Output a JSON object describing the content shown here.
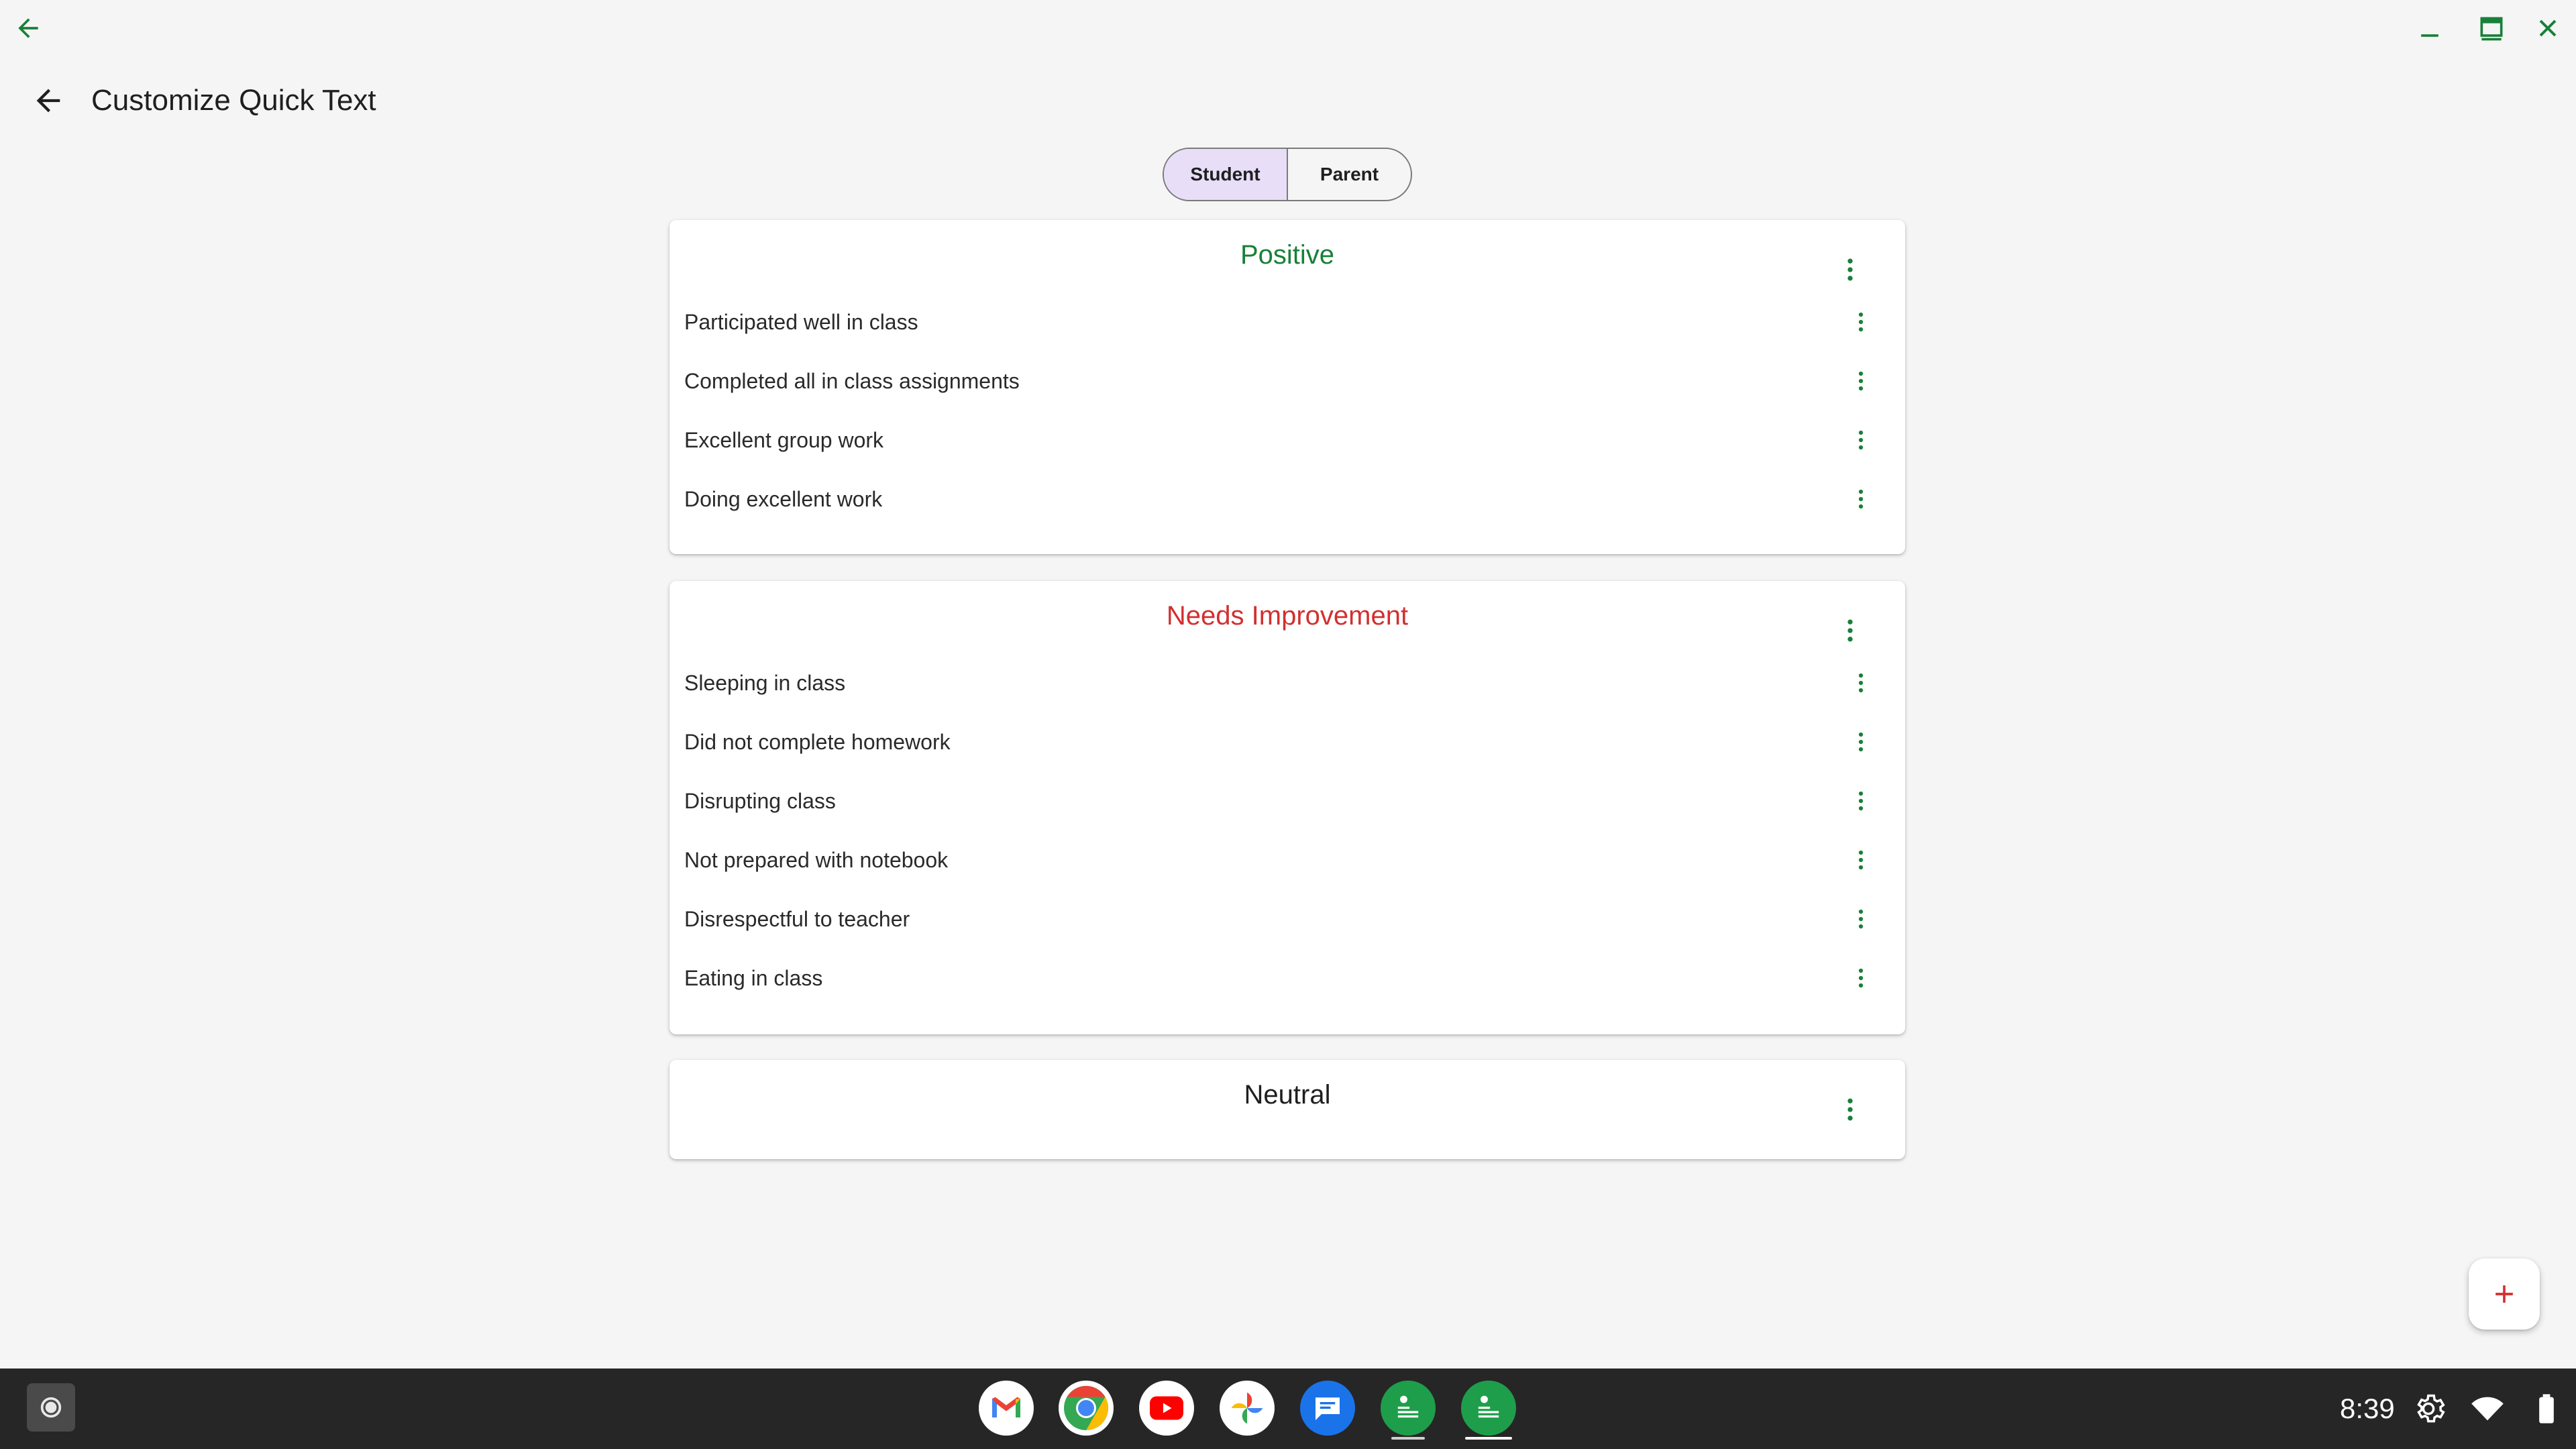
{
  "colors": {
    "accent": "#188038",
    "positive": "#188038",
    "needs_improvement": "#d32f2f",
    "neutral": "#1f1f1f",
    "segment_selected": "#e8def8",
    "fab_plus": "#d32f2f"
  },
  "window": {
    "back_icon": "arrow-left-icon",
    "minimize_icon": "minimize-icon",
    "maximize_icon": "maximize-icon",
    "close_icon": "close-icon"
  },
  "app_bar": {
    "back_icon": "arrow-left-icon",
    "title": "Customize Quick Text"
  },
  "segments": [
    {
      "label": "Student",
      "selected": true
    },
    {
      "label": "Parent",
      "selected": false
    }
  ],
  "sections": [
    {
      "title": "Positive",
      "items": [
        "Participated well in class",
        "Completed all in class assignments",
        "Excellent group work",
        "Doing excellent work"
      ]
    },
    {
      "title": "Needs Improvement",
      "items": [
        "Sleeping in class",
        "Did not complete homework",
        "Disrupting class",
        "Not prepared with notebook",
        "Disrespectful to teacher",
        "Eating in class"
      ]
    },
    {
      "title": "Neutral",
      "items": []
    }
  ],
  "fab": {
    "icon": "plus-icon"
  },
  "shelf": {
    "launcher_icon": "launcher-icon",
    "apps": [
      "gmail-icon",
      "chrome-icon",
      "youtube-icon",
      "photos-icon",
      "messages-icon",
      "quick-text-app-icon",
      "quick-text-app-icon"
    ],
    "time": "8:39",
    "settings_icon": "gear-icon",
    "wifi_icon": "wifi-icon",
    "battery_icon": "battery-icon"
  }
}
